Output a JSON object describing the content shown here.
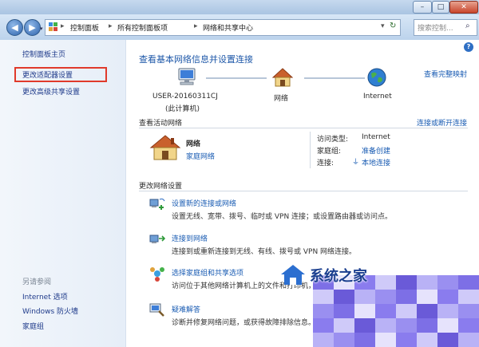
{
  "window": {
    "buttons": {
      "minimize": "–",
      "maximize": "□",
      "close": "✕"
    }
  },
  "address": {
    "crumbs": [
      "控制面板",
      "所有控制面板项",
      "网络和共享中心"
    ],
    "search_placeholder": "搜索控制..."
  },
  "sidebar": {
    "links": [
      "控制面板主页",
      "更改适配器设置",
      "更改高级共享设置"
    ],
    "see_also_title": "另请参阅",
    "see_also": [
      "Internet 选项",
      "Windows 防火墙",
      "家庭组"
    ]
  },
  "main": {
    "heading": "查看基本网络信息并设置连接",
    "view_full_map": "查看完整映射",
    "map_nodes": [
      {
        "label": "USER-20160311CJ",
        "sublabel": "(此计算机)"
      },
      {
        "label": "网络",
        "sublabel": ""
      },
      {
        "label": "Internet",
        "sublabel": ""
      }
    ],
    "active_section": "查看活动网络",
    "connect_disconnect": "连接或断开连接",
    "network_name": "网络",
    "network_type": "家庭网络",
    "access_type_label": "访问类型:",
    "access_type_value": "Internet",
    "homegroup_label": "家庭组:",
    "homegroup_value": "准备创建",
    "connection_label": "连接:",
    "connection_value": "本地连接",
    "settings_section": "更改网络设置",
    "tasks": [
      {
        "title": "设置新的连接或网络",
        "desc": "设置无线、宽带、拨号、临时或 VPN 连接；或设置路由器或访问点。"
      },
      {
        "title": "连接到网络",
        "desc": "连接到或重新连接到无线、有线、拨号或 VPN 网络连接。"
      },
      {
        "title": "选择家庭组和共享选项",
        "desc": "访问位于其他网络计算机上的文件和打印机，或更改共享设置。"
      },
      {
        "title": "疑难解答",
        "desc": "诊断并修复网络问题，或获得故障排除信息。"
      }
    ]
  },
  "watermark": {
    "text": "系统之家"
  }
}
